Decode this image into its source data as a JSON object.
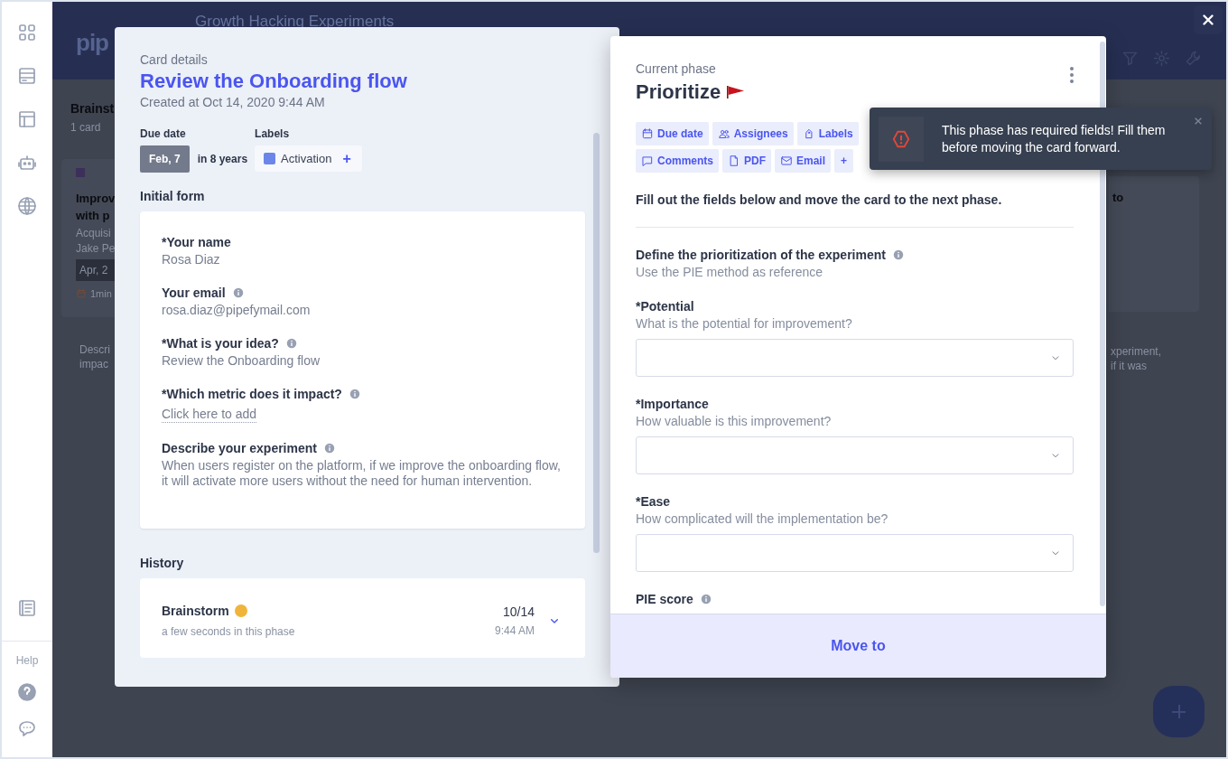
{
  "sidebar": {
    "help_label": "Help"
  },
  "background": {
    "logo": "pip",
    "board_title": "Growth Hacking Experiments",
    "phase_title": "Brainst",
    "phase_count": "1 card",
    "card": {
      "title_lines": [
        "Improv",
        "with p"
      ],
      "subtitle": "Acquisi",
      "assignee": "Jake Pe",
      "due": "Apr, 2",
      "time": "1min"
    },
    "description_lines": [
      "Descri",
      "impac"
    ],
    "right_card_text": "to",
    "right_description_lines": [
      "xperiment,",
      "if it was"
    ]
  },
  "card_details": {
    "heading": "Card details",
    "title": "Review the Onboarding flow",
    "created": "Created at Oct 14, 2020 9:44 AM",
    "due_label": "Due date",
    "due_chip": "Feb, 7",
    "due_relative": "in 8 years",
    "labels_label": "Labels",
    "labels": [
      {
        "name": "Activation",
        "color": "#6b86e8"
      }
    ],
    "add_label": "+",
    "form_heading": "Initial form",
    "fields": [
      {
        "label": "*Your name",
        "info": false,
        "kind": "text",
        "value": "Rosa Diaz"
      },
      {
        "label": "Your email",
        "info": true,
        "kind": "text",
        "value": "rosa.diaz@pipefymail.com"
      },
      {
        "label": "*What is your idea?",
        "info": true,
        "kind": "text",
        "value": "Review the Onboarding flow"
      },
      {
        "label": "*Which metric does it impact?",
        "info": true,
        "kind": "link",
        "value": "Click here to add"
      },
      {
        "label": "Describe your experiment",
        "info": true,
        "kind": "text",
        "value": "When users register on the platform, if we improve the onboarding flow, it will activate more users without the need for human intervention."
      }
    ],
    "history_heading": "History",
    "history": [
      {
        "phase": "Brainstorm",
        "duration": "a few seconds in this phase",
        "date": "10/14",
        "time": "9:44 AM"
      }
    ]
  },
  "current_phase": {
    "heading": "Current phase",
    "title": "Prioritize",
    "actions": [
      {
        "kind": "date",
        "label": "Due date"
      },
      {
        "kind": "people",
        "label": "Assignees"
      },
      {
        "kind": "label",
        "label": "Labels"
      },
      {
        "kind": "comment",
        "label": "Comments"
      },
      {
        "kind": "file",
        "label": "PDF"
      },
      {
        "kind": "mail",
        "label": "Email"
      },
      {
        "kind": "add",
        "label": "+"
      }
    ],
    "instructions": "Fill out the fields below and move the card to the next phase.",
    "section": {
      "title": "Define the prioritization of the experiment",
      "hint": "Use the PIE method as reference",
      "info": true
    },
    "fields": [
      {
        "kind": "select",
        "label": "*Potential",
        "hint": "What is the potential for improvement?"
      },
      {
        "kind": "select",
        "label": "*Importance",
        "hint": "How valuable is this improvement?"
      },
      {
        "kind": "select",
        "label": "*Ease",
        "hint": "How complicated will the implementation be?"
      },
      {
        "kind": "score",
        "label": "PIE score",
        "info": true
      }
    ],
    "move_button": "Move to"
  },
  "toast": {
    "message": "This phase has required fields! Fill them before moving the card forward."
  }
}
